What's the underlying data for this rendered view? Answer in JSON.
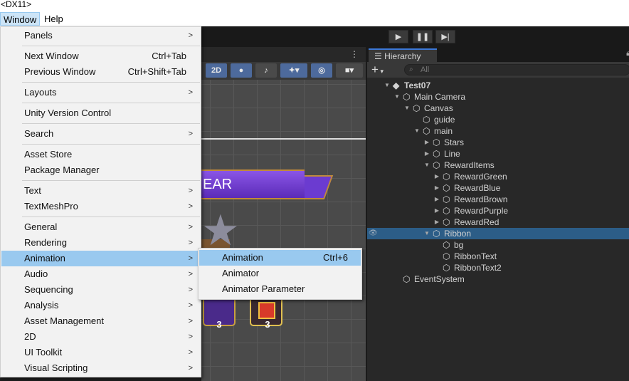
{
  "titlebar": {
    "text": "<DX11>"
  },
  "menubar": {
    "window": "Window",
    "help": "Help"
  },
  "toolbar": {
    "play_icon": "play-icon",
    "pause_icon": "pause-icon",
    "step_icon": "step-icon"
  },
  "scene": {
    "toolbar": {
      "mode_2d": "2D"
    },
    "banner_text": "EAR",
    "item_counts": [
      "3",
      "3"
    ]
  },
  "hierarchy": {
    "tab_label": "Hierarchy",
    "add_label": "+",
    "search_placeholder": "All",
    "rows": [
      {
        "label": "Test07",
        "depth": 0,
        "arrow": "down",
        "kind": "scene"
      },
      {
        "label": "Main Camera",
        "depth": 1,
        "arrow": "down",
        "kind": "object"
      },
      {
        "label": "Canvas",
        "depth": 2,
        "arrow": "down",
        "kind": "object"
      },
      {
        "label": "guide",
        "depth": 3,
        "arrow": "",
        "kind": "object"
      },
      {
        "label": "main",
        "depth": 3,
        "arrow": "down",
        "kind": "object"
      },
      {
        "label": "Stars",
        "depth": 4,
        "arrow": "right",
        "kind": "object"
      },
      {
        "label": "Line",
        "depth": 4,
        "arrow": "right",
        "kind": "object"
      },
      {
        "label": "RewardItems",
        "depth": 4,
        "arrow": "down",
        "kind": "object"
      },
      {
        "label": "RewardGreen",
        "depth": 5,
        "arrow": "right",
        "kind": "object"
      },
      {
        "label": "RewardBlue",
        "depth": 5,
        "arrow": "right",
        "kind": "object"
      },
      {
        "label": "RewardBrown",
        "depth": 5,
        "arrow": "right",
        "kind": "object"
      },
      {
        "label": "RewardPurple",
        "depth": 5,
        "arrow": "right",
        "kind": "object"
      },
      {
        "label": "RewardRed",
        "depth": 5,
        "arrow": "right",
        "kind": "object"
      },
      {
        "label": "Ribbon",
        "depth": 4,
        "arrow": "down",
        "kind": "object",
        "selected": true
      },
      {
        "label": "bg",
        "depth": 5,
        "arrow": "",
        "kind": "object"
      },
      {
        "label": "RibbonText",
        "depth": 5,
        "arrow": "",
        "kind": "object"
      },
      {
        "label": "RibbonText2",
        "depth": 5,
        "arrow": "",
        "kind": "object"
      },
      {
        "label": "EventSystem",
        "depth": 1,
        "arrow": "",
        "kind": "object"
      }
    ]
  },
  "window_menu": {
    "items": [
      {
        "label": "Panels",
        "submenu": true
      },
      {
        "sep": true
      },
      {
        "label": "Next Window",
        "shortcut": "Ctrl+Tab"
      },
      {
        "label": "Previous Window",
        "shortcut": "Ctrl+Shift+Tab"
      },
      {
        "sep": true
      },
      {
        "label": "Layouts",
        "submenu": true
      },
      {
        "sep": true
      },
      {
        "label": "Unity Version Control"
      },
      {
        "sep": true
      },
      {
        "label": "Search",
        "submenu": true
      },
      {
        "sep": true
      },
      {
        "label": "Asset Store"
      },
      {
        "label": "Package Manager"
      },
      {
        "sep": true
      },
      {
        "label": "Text",
        "submenu": true
      },
      {
        "label": "TextMeshPro",
        "submenu": true
      },
      {
        "sep": true
      },
      {
        "label": "General",
        "submenu": true
      },
      {
        "label": "Rendering",
        "submenu": true
      },
      {
        "label": "Animation",
        "submenu": true,
        "highlighted": true
      },
      {
        "label": "Audio",
        "submenu": true
      },
      {
        "label": "Sequencing",
        "submenu": true
      },
      {
        "label": "Analysis",
        "submenu": true
      },
      {
        "label": "Asset Management",
        "submenu": true
      },
      {
        "label": "2D",
        "submenu": true
      },
      {
        "label": "UI Toolkit",
        "submenu": true
      },
      {
        "label": "Visual Scripting",
        "submenu": true
      }
    ],
    "submenu_arrow": ">"
  },
  "animation_submenu": {
    "items": [
      {
        "label": "Animation",
        "shortcut": "Ctrl+6",
        "highlighted": true
      },
      {
        "label": "Animator"
      },
      {
        "label": "Animator Parameter"
      }
    ]
  },
  "colors": {
    "menu_highlight": "#99c9ef",
    "selected_row": "#2c5d87",
    "accent": "#4d6a9c"
  }
}
